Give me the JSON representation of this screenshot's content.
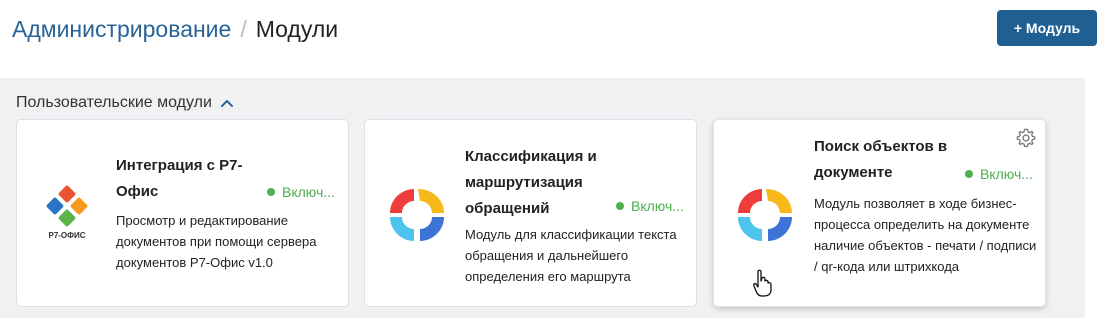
{
  "breadcrumb": {
    "parent": "Администрирование",
    "separator": "/",
    "current": "Модули"
  },
  "toolbar": {
    "add_label": "+ Модуль"
  },
  "section": {
    "title": "Пользовательские модули"
  },
  "cards": [
    {
      "title": "Интеграция с Р7-Офис",
      "status": "Включ...",
      "description": "Просмотр и редактирование документов при помощи сервера документов Р7-Офис v1.0",
      "logo_caption": "Р7-ОФИС",
      "logo": "r7-office-logo"
    },
    {
      "title": "Классификация и маршрутизация обращений",
      "status": "Включ...",
      "description": "Модуль для классификации текста обращения и дальнейшего определения его маршрута",
      "logo": "elma-ring-logo"
    },
    {
      "title": "Поиск объектов в документе",
      "status": "Включ...",
      "description": "Модуль позволяет в ходе бизнес-процесса определить на документе наличие объектов - печати / подписи / qr-кода или штрихкода",
      "logo": "elma-ring-logo"
    }
  ],
  "colors": {
    "link": "#2a6496",
    "button": "#1f5f92",
    "status": "#4caf50",
    "section_bg": "#f0f1f3"
  }
}
